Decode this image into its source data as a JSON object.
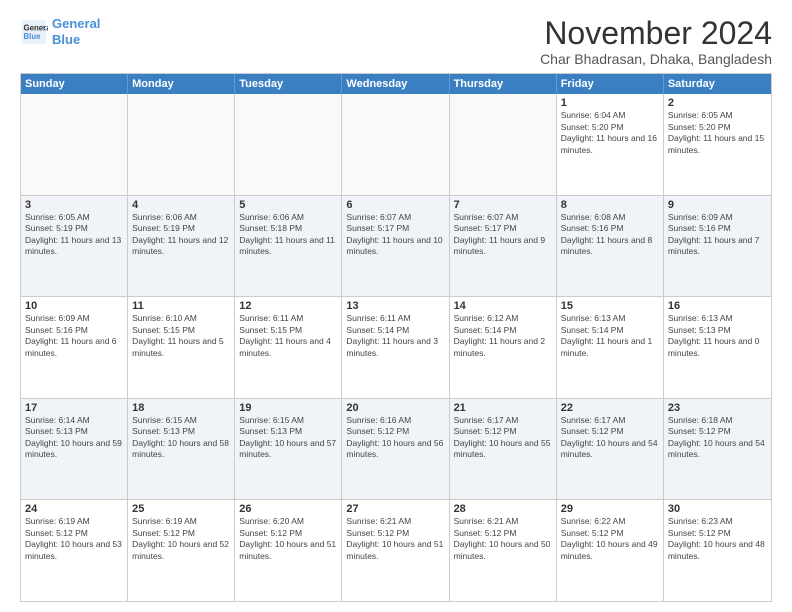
{
  "logo": {
    "line1": "General",
    "line2": "Blue"
  },
  "title": "November 2024",
  "location": "Char Bhadrasan, Dhaka, Bangladesh",
  "header_days": [
    "Sunday",
    "Monday",
    "Tuesday",
    "Wednesday",
    "Thursday",
    "Friday",
    "Saturday"
  ],
  "weeks": [
    [
      {
        "day": "",
        "info": ""
      },
      {
        "day": "",
        "info": ""
      },
      {
        "day": "",
        "info": ""
      },
      {
        "day": "",
        "info": ""
      },
      {
        "day": "",
        "info": ""
      },
      {
        "day": "1",
        "info": "Sunrise: 6:04 AM\nSunset: 5:20 PM\nDaylight: 11 hours and 16 minutes."
      },
      {
        "day": "2",
        "info": "Sunrise: 6:05 AM\nSunset: 5:20 PM\nDaylight: 11 hours and 15 minutes."
      }
    ],
    [
      {
        "day": "3",
        "info": "Sunrise: 6:05 AM\nSunset: 5:19 PM\nDaylight: 11 hours and 13 minutes."
      },
      {
        "day": "4",
        "info": "Sunrise: 6:06 AM\nSunset: 5:19 PM\nDaylight: 11 hours and 12 minutes."
      },
      {
        "day": "5",
        "info": "Sunrise: 6:06 AM\nSunset: 5:18 PM\nDaylight: 11 hours and 11 minutes."
      },
      {
        "day": "6",
        "info": "Sunrise: 6:07 AM\nSunset: 5:17 PM\nDaylight: 11 hours and 10 minutes."
      },
      {
        "day": "7",
        "info": "Sunrise: 6:07 AM\nSunset: 5:17 PM\nDaylight: 11 hours and 9 minutes."
      },
      {
        "day": "8",
        "info": "Sunrise: 6:08 AM\nSunset: 5:16 PM\nDaylight: 11 hours and 8 minutes."
      },
      {
        "day": "9",
        "info": "Sunrise: 6:09 AM\nSunset: 5:16 PM\nDaylight: 11 hours and 7 minutes."
      }
    ],
    [
      {
        "day": "10",
        "info": "Sunrise: 6:09 AM\nSunset: 5:16 PM\nDaylight: 11 hours and 6 minutes."
      },
      {
        "day": "11",
        "info": "Sunrise: 6:10 AM\nSunset: 5:15 PM\nDaylight: 11 hours and 5 minutes."
      },
      {
        "day": "12",
        "info": "Sunrise: 6:11 AM\nSunset: 5:15 PM\nDaylight: 11 hours and 4 minutes."
      },
      {
        "day": "13",
        "info": "Sunrise: 6:11 AM\nSunset: 5:14 PM\nDaylight: 11 hours and 3 minutes."
      },
      {
        "day": "14",
        "info": "Sunrise: 6:12 AM\nSunset: 5:14 PM\nDaylight: 11 hours and 2 minutes."
      },
      {
        "day": "15",
        "info": "Sunrise: 6:13 AM\nSunset: 5:14 PM\nDaylight: 11 hours and 1 minute."
      },
      {
        "day": "16",
        "info": "Sunrise: 6:13 AM\nSunset: 5:13 PM\nDaylight: 11 hours and 0 minutes."
      }
    ],
    [
      {
        "day": "17",
        "info": "Sunrise: 6:14 AM\nSunset: 5:13 PM\nDaylight: 10 hours and 59 minutes."
      },
      {
        "day": "18",
        "info": "Sunrise: 6:15 AM\nSunset: 5:13 PM\nDaylight: 10 hours and 58 minutes."
      },
      {
        "day": "19",
        "info": "Sunrise: 6:15 AM\nSunset: 5:13 PM\nDaylight: 10 hours and 57 minutes."
      },
      {
        "day": "20",
        "info": "Sunrise: 6:16 AM\nSunset: 5:12 PM\nDaylight: 10 hours and 56 minutes."
      },
      {
        "day": "21",
        "info": "Sunrise: 6:17 AM\nSunset: 5:12 PM\nDaylight: 10 hours and 55 minutes."
      },
      {
        "day": "22",
        "info": "Sunrise: 6:17 AM\nSunset: 5:12 PM\nDaylight: 10 hours and 54 minutes."
      },
      {
        "day": "23",
        "info": "Sunrise: 6:18 AM\nSunset: 5:12 PM\nDaylight: 10 hours and 54 minutes."
      }
    ],
    [
      {
        "day": "24",
        "info": "Sunrise: 6:19 AM\nSunset: 5:12 PM\nDaylight: 10 hours and 53 minutes."
      },
      {
        "day": "25",
        "info": "Sunrise: 6:19 AM\nSunset: 5:12 PM\nDaylight: 10 hours and 52 minutes."
      },
      {
        "day": "26",
        "info": "Sunrise: 6:20 AM\nSunset: 5:12 PM\nDaylight: 10 hours and 51 minutes."
      },
      {
        "day": "27",
        "info": "Sunrise: 6:21 AM\nSunset: 5:12 PM\nDaylight: 10 hours and 51 minutes."
      },
      {
        "day": "28",
        "info": "Sunrise: 6:21 AM\nSunset: 5:12 PM\nDaylight: 10 hours and 50 minutes."
      },
      {
        "day": "29",
        "info": "Sunrise: 6:22 AM\nSunset: 5:12 PM\nDaylight: 10 hours and 49 minutes."
      },
      {
        "day": "30",
        "info": "Sunrise: 6:23 AM\nSunset: 5:12 PM\nDaylight: 10 hours and 48 minutes."
      }
    ]
  ]
}
